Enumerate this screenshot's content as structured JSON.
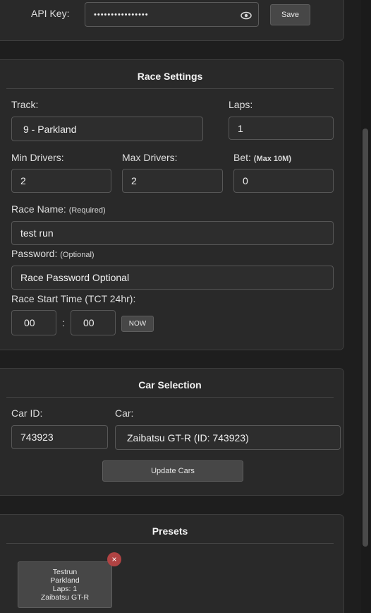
{
  "api": {
    "label": "API Key:",
    "value": "••••••••••••••••",
    "save_label": "Save",
    "eye_icon": "eye-icon"
  },
  "race_settings": {
    "title": "Race Settings",
    "track_label": "Track:",
    "track_value": "9 - Parkland",
    "laps_label": "Laps:",
    "laps_value": "1",
    "min_drivers_label": "Min Drivers:",
    "min_drivers_value": "2",
    "max_drivers_label": "Max Drivers:",
    "max_drivers_value": "2",
    "bet_label": "Bet:",
    "bet_hint": "(Max 10M)",
    "bet_value": "0",
    "race_name_label": "Race Name:",
    "race_name_hint": "(Required)",
    "race_name_value": "test run",
    "password_label": "Password:",
    "password_hint": "(Optional)",
    "password_placeholder": "Race Password Optional",
    "start_time_label": "Race Start Time (TCT 24hr):",
    "hour_value": "00",
    "time_separator": ":",
    "minute_value": "00",
    "now_label": "NOW"
  },
  "car_selection": {
    "title": "Car Selection",
    "car_id_label": "Car ID:",
    "car_id_value": "743923",
    "car_label": "Car:",
    "car_value": "Zaibatsu GT-R (ID: 743923)",
    "update_label": "Update Cars"
  },
  "presets": {
    "title": "Presets",
    "items": [
      {
        "name": "Testrun",
        "track": "Parkland",
        "laps": "Laps: 1",
        "car": "Zaibatsu GT-R",
        "remove_label": "×"
      }
    ]
  },
  "colors": {
    "background": "#1e1e1e",
    "panel": "#292929",
    "input": "#2d2d2d",
    "button": "#474747",
    "remove_badge": "#b04343"
  }
}
